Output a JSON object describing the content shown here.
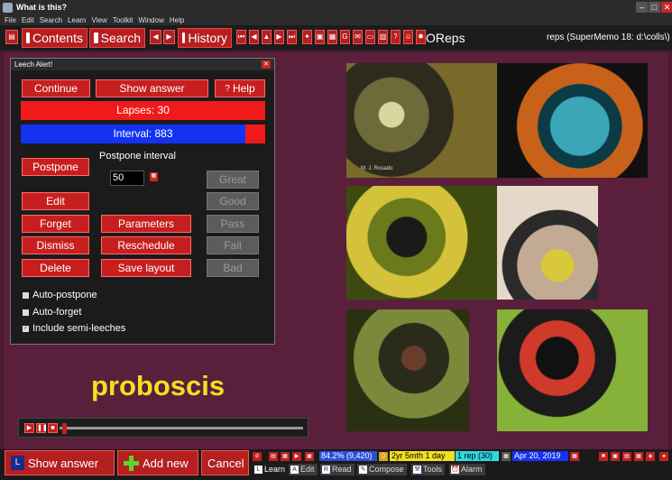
{
  "window": {
    "title": "What is this?"
  },
  "menu": [
    "File",
    "Edit",
    "Search",
    "Learn",
    "View",
    "Toolkit",
    "Window",
    "Help"
  ],
  "toolbar": {
    "contents_label": "Contents",
    "search_label": "Search",
    "history_label": "History",
    "oreps_label": "OReps",
    "status": "reps (SuperMemo 18: d:\\colls\\)"
  },
  "dialog": {
    "title": "Leech Alert!",
    "continue_label": "Continue",
    "show_answer_label": "Show answer",
    "help_label": "Help",
    "lapses_text": "Lapses: 30",
    "interval_text": "Interval: 883",
    "postpone_label": "Postpone",
    "postpone_interval_label": "Postpone interval",
    "postpone_interval_value": "50",
    "edit_label": "Edit",
    "forget_label": "Forget",
    "dismiss_label": "Dismiss",
    "delete_label": "Delete",
    "parameters_label": "Parameters",
    "reschedule_label": "Reschedule",
    "save_layout_label": "Save layout",
    "great_label": "Great",
    "good_label": "Good",
    "pass_label": "Pass",
    "fail_label": "Fail",
    "bad_label": "Bad",
    "auto_postpone_label": "Auto-postpone",
    "auto_forget_label": "Auto-forget",
    "semi_leeches_label": "Include semi-leeches",
    "semi_leeches_checked": true
  },
  "card": {
    "keyword": "proboscis",
    "photo_credit": "M. J. Rosado"
  },
  "bottom": {
    "show_answer_label": "Show answer",
    "add_new_label": "Add new",
    "cancel_label": "Cancel",
    "progress": "84.2% (9,420)",
    "interval": "2yr 5mth 1 day",
    "reps": "1 rep (30)",
    "date": "Apr 20, 2019",
    "tabs": [
      "Learn",
      "Edit",
      "Read",
      "Compose",
      "Tools",
      "Alarm"
    ]
  },
  "colors": {
    "accent_red": "#c71f1f",
    "interval_blue": "#1432f2",
    "keyword_yellow": "#f1e021",
    "background": "#5a1f3a"
  }
}
